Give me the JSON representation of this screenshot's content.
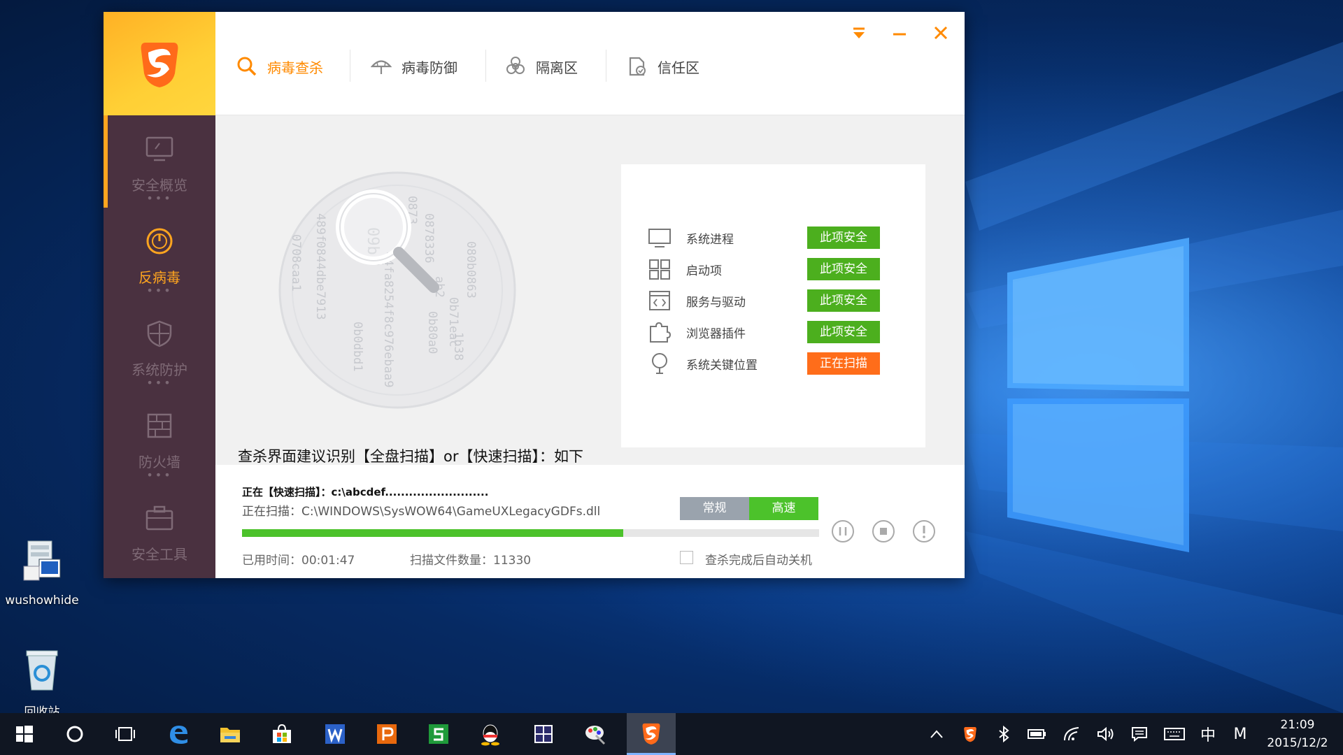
{
  "desktop": {
    "icons": [
      {
        "label": "wushowhide"
      },
      {
        "label": "回收站"
      }
    ]
  },
  "app": {
    "tabs": [
      {
        "label": "病毒查杀",
        "icon": "search-icon",
        "active": true
      },
      {
        "label": "病毒防御",
        "icon": "umbrella-icon"
      },
      {
        "label": "隔离区",
        "icon": "biohazard-icon"
      },
      {
        "label": "信任区",
        "icon": "trusted-doc-icon"
      }
    ],
    "sidebar": [
      {
        "label": "安全概览",
        "icon": "monitor-icon"
      },
      {
        "label": "反病毒",
        "icon": "gauge-icon",
        "active": true
      },
      {
        "label": "系统防护",
        "icon": "shield-icon"
      },
      {
        "label": "防火墙",
        "icon": "firewall-icon"
      },
      {
        "label": "安全工具",
        "icon": "toolbox-icon"
      }
    ],
    "dots": "•••",
    "scan_items": [
      {
        "name": "系统进程",
        "status": "此项安全",
        "icon": "monitor-icon"
      },
      {
        "name": "启动项",
        "status": "此项安全",
        "icon": "windows-grid-icon"
      },
      {
        "name": "服务与驱动",
        "status": "此项安全",
        "icon": "code-window-icon"
      },
      {
        "name": "浏览器插件",
        "status": "此项安全",
        "icon": "puzzle-icon"
      },
      {
        "name": "系统关键位置",
        "status": "正在扫描",
        "icon": "location-pin-icon",
        "scanning": true
      }
    ],
    "hint": "查杀界面建议识别【全盘扫描】or【快速扫描】：如下",
    "scan_title": "正在【快速扫描】：c:\\abcdef..........................",
    "scan_path": "正在扫描：C:\\WINDOWS\\SysWOW64\\GameUXLegacyGDFs.dll",
    "modes": {
      "normal": "常规",
      "fast": "高速"
    },
    "progress_fraction": 0.66,
    "elapsed": "已用时间：00:01:47",
    "files": "扫描文件数量：11330",
    "auto_shutdown": "查杀完成后自动关机",
    "radar_text": [
      "489f",
      "0844dbe7913",
      "0708caa1",
      "09b",
      "6",
      "0873",
      "0878336",
      "ab2",
      "44fa8254f8c976ebaa9",
      "0b0dbd1",
      "0b80a0",
      "0b71eac",
      "080b0863",
      "1b38"
    ],
    "colors": {
      "accent": "#ff8a00",
      "safe": "#4caf1e",
      "scanning": "#ff6d1a",
      "sidebar": "#4a3140"
    }
  },
  "taskbar": {
    "time": "21:09",
    "date": "2015/12/2",
    "ime": "中",
    "ime2": "M",
    "apps": [
      "windows-start-icon",
      "cortana-icon",
      "task-view-icon",
      "edge-icon",
      "file-explorer-icon",
      "store-icon",
      "wps-writer-icon",
      "wps-presentation-icon",
      "wps-spreadsheet-icon",
      "qq-icon",
      "calculator-icon",
      "paint-icon",
      "huorong-icon"
    ]
  }
}
